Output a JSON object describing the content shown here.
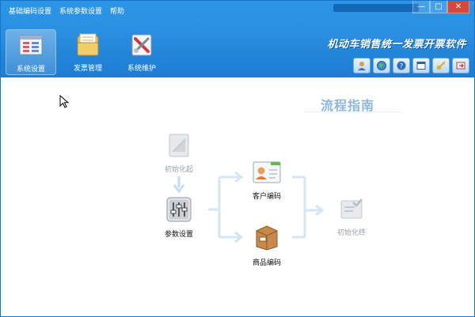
{
  "menu": {
    "items": [
      "基础编码设置",
      "系统参数设置",
      "帮助"
    ]
  },
  "window_controls": {
    "minimize": "—",
    "maximize": "□",
    "close": "✕"
  },
  "nav": {
    "items": [
      {
        "label": "系统设置",
        "icon": "settings-window-icon",
        "active": true
      },
      {
        "label": "发票管理",
        "icon": "folder-icon",
        "active": false
      },
      {
        "label": "系统维护",
        "icon": "tools-icon",
        "active": false
      }
    ]
  },
  "brand": {
    "title": "机动车销售统一发票开票软件"
  },
  "toolbar": {
    "icons": [
      "user-icon",
      "globe-icon",
      "help-icon",
      "window-icon",
      "key-icon",
      "exit-icon"
    ]
  },
  "guide": {
    "title": "流程指南",
    "nodes": {
      "init_start": {
        "label": "初始化起",
        "icon": "init-icon",
        "enabled": false
      },
      "params": {
        "label": "参数设置",
        "icon": "sliders-icon",
        "enabled": true
      },
      "customer": {
        "label": "客户编码",
        "icon": "contact-card-icon",
        "enabled": true
      },
      "product": {
        "label": "商品编码",
        "icon": "box-icon",
        "enabled": true
      },
      "init_end": {
        "label": "初始化终",
        "icon": "finish-icon",
        "enabled": false
      }
    }
  },
  "colors": {
    "title_bar": "#2b8fe0",
    "arrow": "#d3e6f5",
    "guide_title": "#8db6da"
  }
}
